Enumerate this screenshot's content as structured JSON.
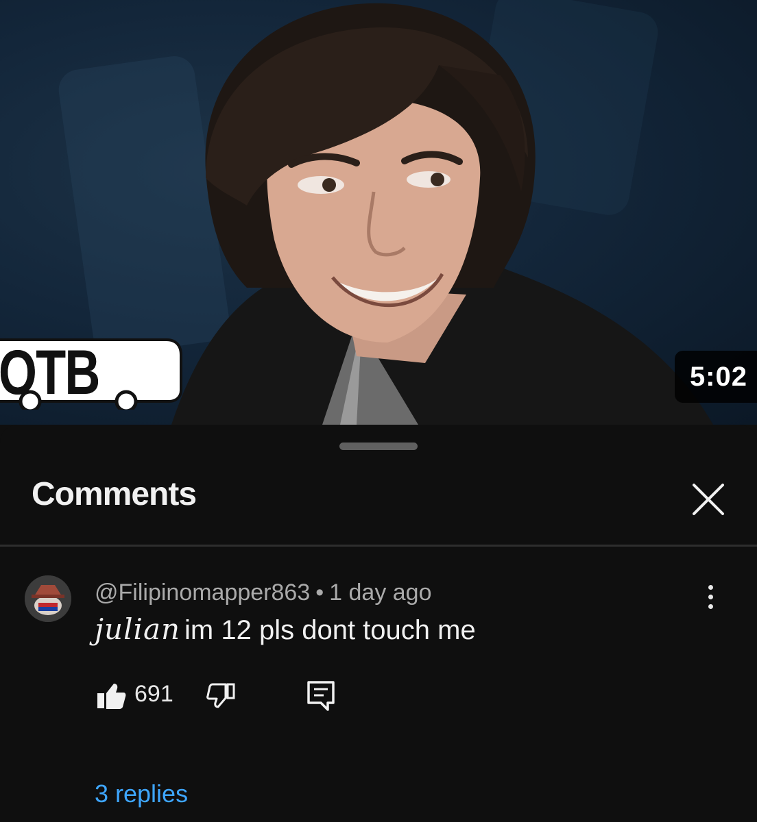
{
  "video": {
    "duration": "5:02",
    "logo_text": "OTB",
    "colors": {
      "background": "#13263a",
      "duration_bg": "#000000"
    }
  },
  "comments_sheet": {
    "title": "Comments",
    "close_icon": "close-icon",
    "comment": {
      "author": "@Filipinomapper863",
      "separator": "•",
      "timestamp": "1 day ago",
      "text_handwritten": "julian",
      "text": "im 12 pls dont touch me",
      "like_count": "691",
      "replies_label": "3 replies",
      "icons": [
        "thumbs-up-icon",
        "thumbs-down-icon",
        "reply-icon",
        "more-vertical-icon"
      ]
    },
    "colors": {
      "background": "#0f0f0f",
      "link": "#3ea6ff",
      "secondary_text": "#aaaaaa"
    }
  }
}
